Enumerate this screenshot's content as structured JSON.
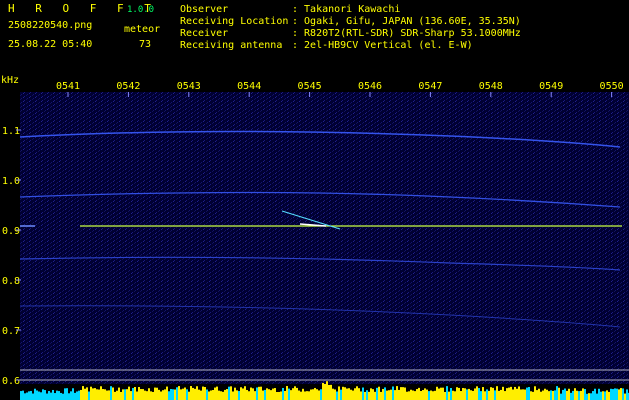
{
  "header": {
    "app_name": "H R O F F T",
    "app_version": "1.0.0",
    "filename": "2508220540.png",
    "datetime": "25.08.22 05:40",
    "type_label": "meteor",
    "count": "73",
    "info": [
      {
        "label": "Observer",
        "value": ": Takanori Kawachi"
      },
      {
        "label": "Receiving Location",
        "value": ": Ogaki, Gifu, JAPAN (136.60E, 35.35N)"
      },
      {
        "label": "Receiver",
        "value": ": R820T2(RTL-SDR) SDR-Sharp 53.1000MHz"
      },
      {
        "label": "Receiving antenna",
        "value": ": 2el-HB9CV Vertical (el. E-W)"
      }
    ]
  },
  "axis": {
    "unit": "kHz",
    "time_ticks": [
      "0541",
      "0542",
      "0543",
      "0544",
      "0545",
      "0546",
      "0547",
      "0548",
      "0549",
      "0550"
    ],
    "freq_ticks": [
      "1.1",
      "1.0",
      "0.9",
      "0.8",
      "0.7",
      "0.6"
    ]
  },
  "colors": {
    "background": "#000000",
    "header_text": "#ffff00",
    "tick_text": "#ffff00",
    "noise": "#0a0a5a",
    "trace": "#3f5fff",
    "carrier": "#c8ff40",
    "level_bar": "#ffee00",
    "level_bar_alt": "#00d8ff"
  }
}
